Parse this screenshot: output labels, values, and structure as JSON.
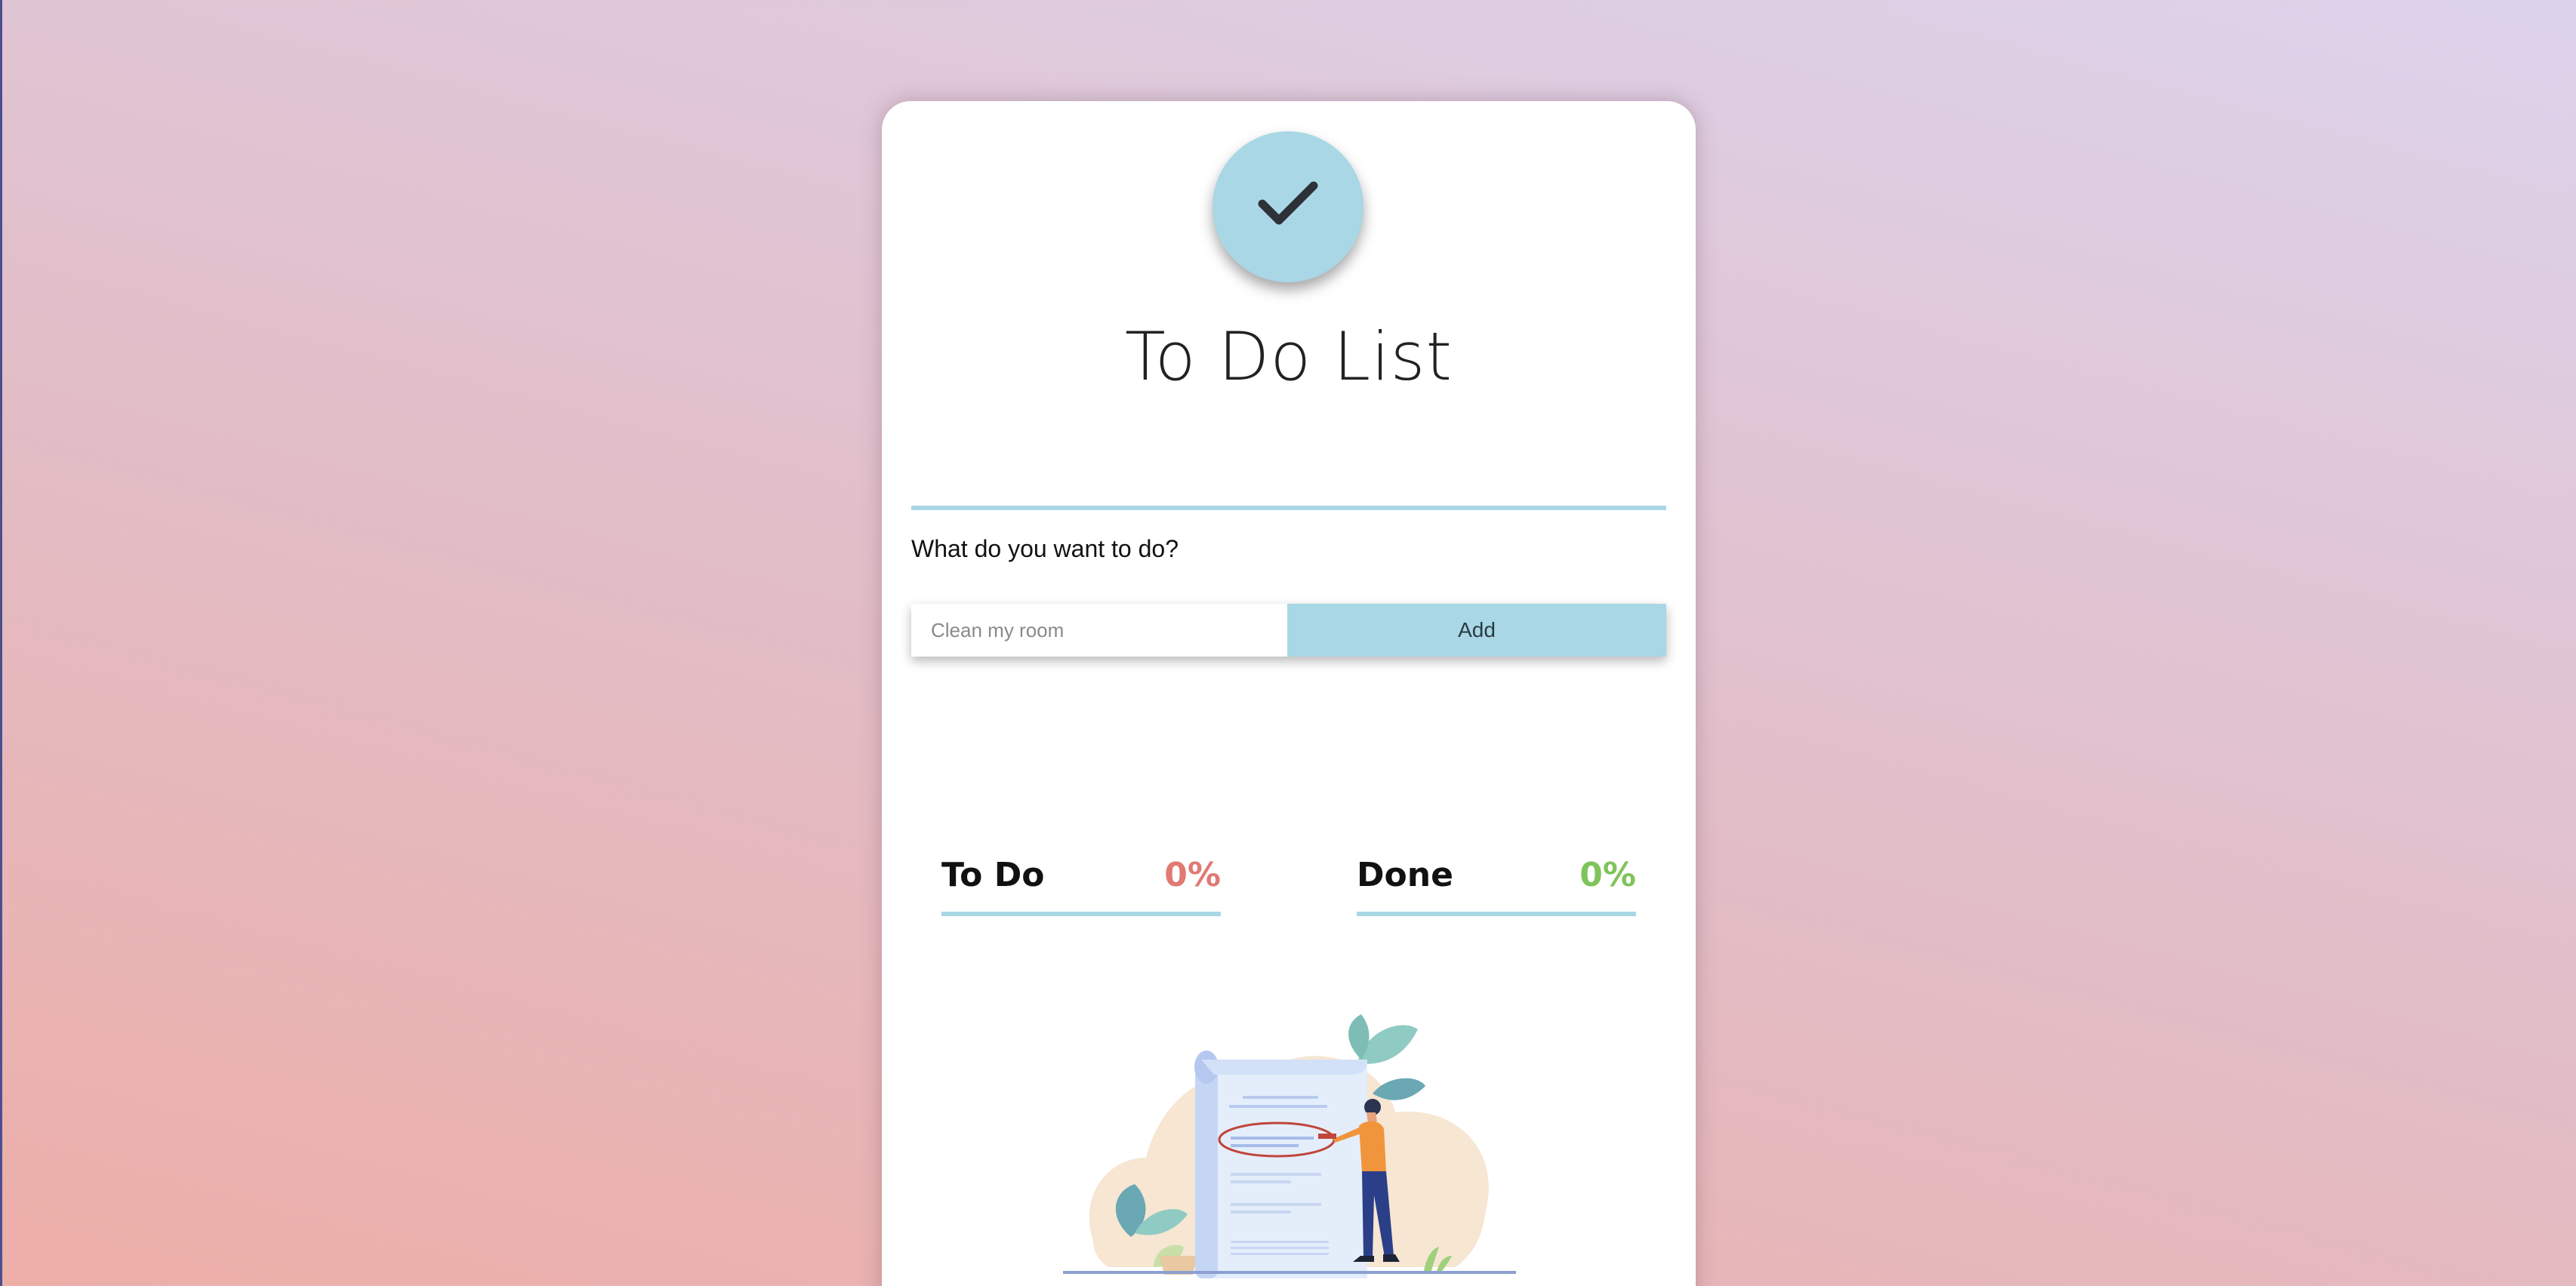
{
  "app": {
    "title": "To Do List",
    "prompt": "What do you want to do?"
  },
  "form": {
    "placeholder": "Clean my room",
    "value": "",
    "add_label": "Add"
  },
  "stats": {
    "todo": {
      "label": "To Do",
      "value": "0%",
      "color": "#e07a73"
    },
    "done": {
      "label": "Done",
      "value": "0%",
      "color": "#7fc45a"
    }
  },
  "colors": {
    "accent": "#a9d7e5",
    "check": "#2e3138"
  },
  "icons": {
    "header": "checkmark-icon",
    "illustration": "person-with-checklist-illustration"
  }
}
